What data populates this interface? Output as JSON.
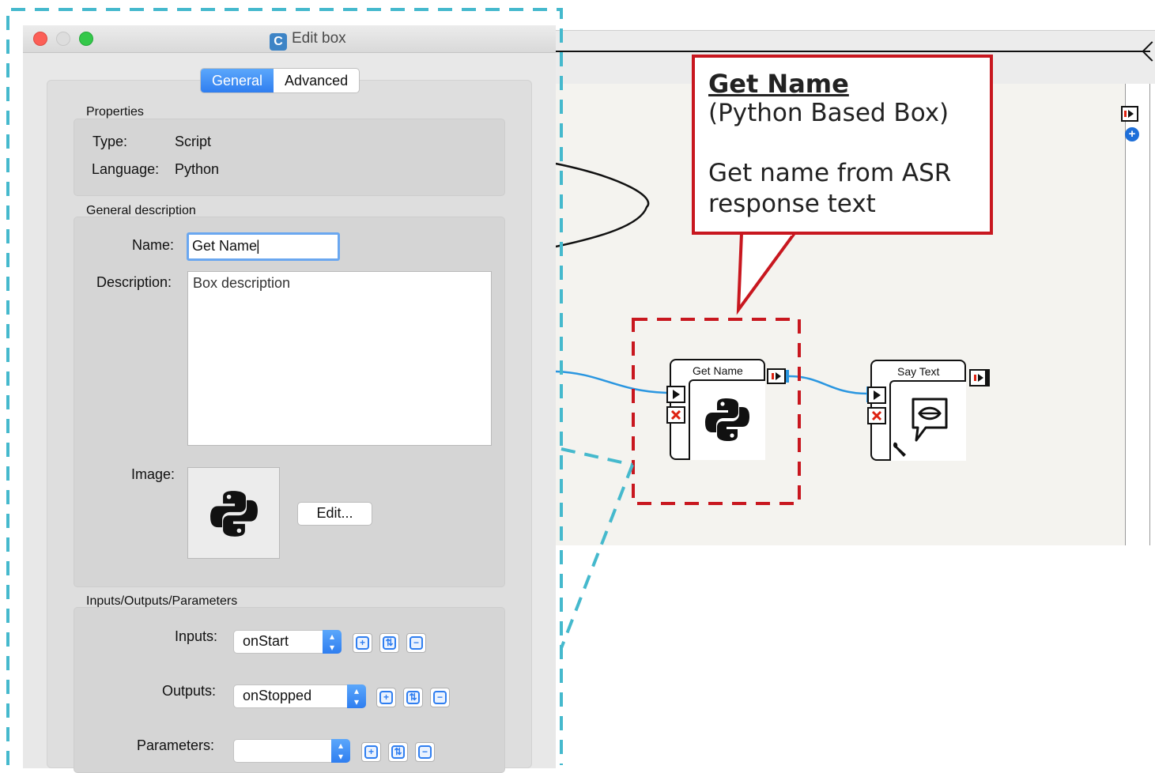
{
  "dialog": {
    "title": "Edit box",
    "title_icon_letter": "C",
    "tabs": [
      {
        "label": "General",
        "active": true
      },
      {
        "label": "Advanced",
        "active": false
      }
    ],
    "properties": {
      "heading": "Properties",
      "type_label": "Type:",
      "type_value": "Script",
      "language_label": "Language:",
      "language_value": "Python"
    },
    "general_description": {
      "heading": "General description",
      "name_label": "Name:",
      "name_value": "Get Name",
      "description_label": "Description:",
      "description_value": "Box description",
      "image_label": "Image:",
      "image_icon": "python-logo-icon",
      "edit_button": "Edit..."
    },
    "io": {
      "heading": "Inputs/Outputs/Parameters",
      "inputs_label": "Inputs:",
      "inputs_selected": "onStart",
      "outputs_label": "Outputs:",
      "outputs_selected": "onStopped",
      "parameters_label": "Parameters:",
      "parameters_selected": ""
    }
  },
  "flow": {
    "get_name_box": {
      "title": "Get Name",
      "icon": "python-logo-icon"
    },
    "say_text_box": {
      "title": "Say Text",
      "icon": "speech-bubble-icon"
    }
  },
  "callout": {
    "title": "Get Name",
    "subtitle": "(Python Based Box)",
    "description": "Get name from ASR response text"
  },
  "colors": {
    "callout_red": "#c8171f",
    "zoom_teal": "#45b9cd",
    "accent_blue": "#2f7ef0",
    "wire_blue": "#2a96e0"
  }
}
